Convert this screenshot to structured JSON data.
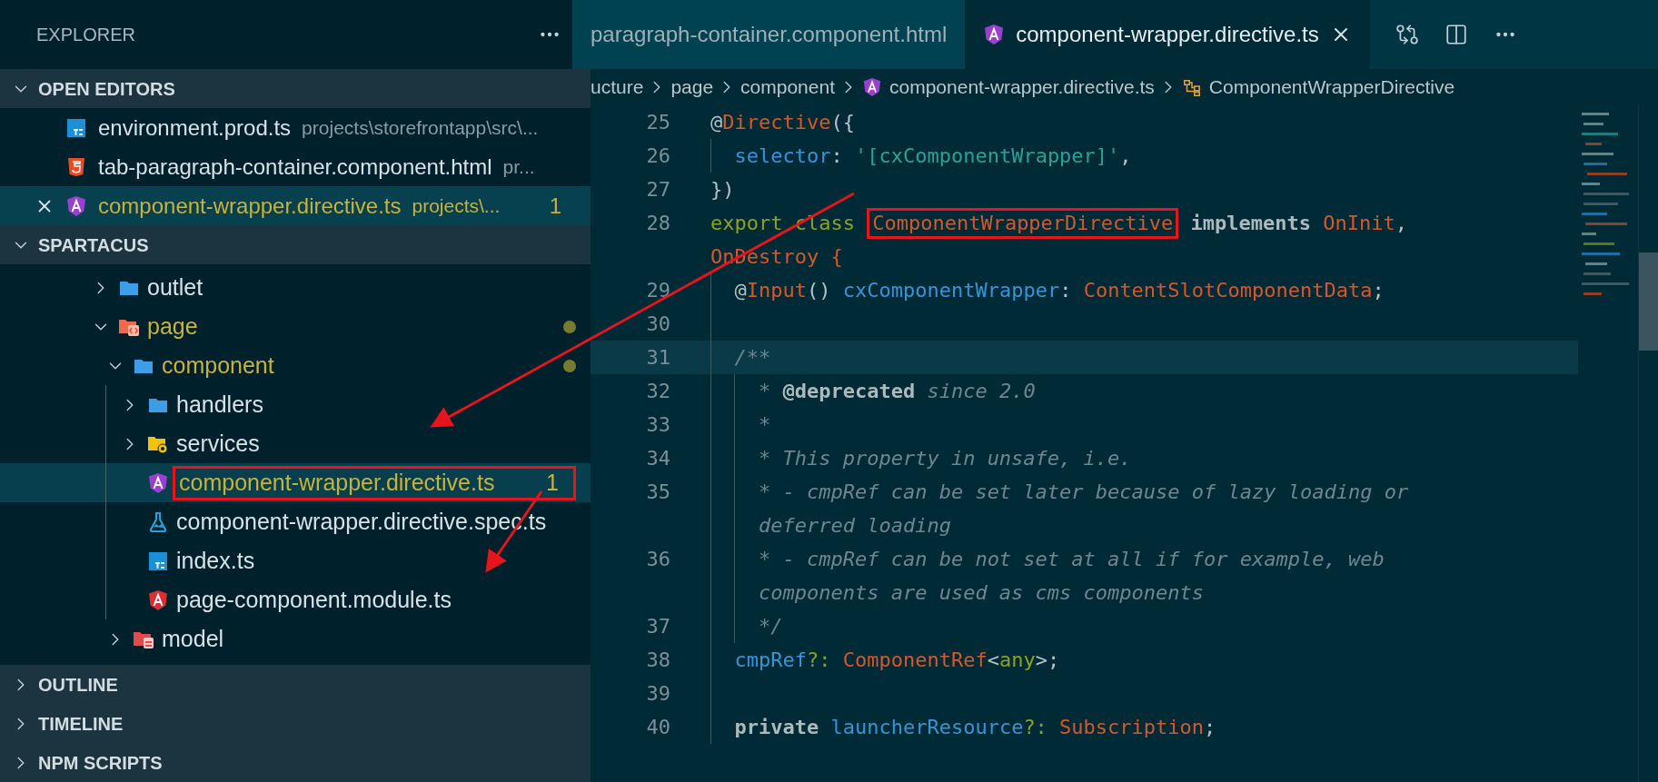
{
  "explorer": {
    "title": "EXPLORER"
  },
  "open_editors": {
    "title": "OPEN EDITORS",
    "expanded": true,
    "items": [
      {
        "name": "environment.prod.ts",
        "path": "projects\\storefrontapp\\src\\...",
        "kind": "ts",
        "selected": false,
        "modified": false
      },
      {
        "name": "tab-paragraph-container.component.html",
        "path": "pr...",
        "kind": "html",
        "selected": false,
        "modified": false
      },
      {
        "name": "component-wrapper.directive.ts",
        "path": "projects\\...",
        "kind": "directive",
        "selected": true,
        "modified": true,
        "badge": "1"
      }
    ]
  },
  "project": {
    "title": "SPARTACUS",
    "expanded": true,
    "tree": [
      {
        "name": "outlet",
        "kind": "folder",
        "expanded": false,
        "modified": false,
        "selected": false
      },
      {
        "name": "page",
        "kind": "folder-page",
        "expanded": true,
        "modified": true,
        "dot": true,
        "selected": false,
        "children": [
          {
            "name": "component",
            "kind": "folder",
            "expanded": true,
            "modified": true,
            "dot": true,
            "selected": false,
            "children": [
              {
                "name": "handlers",
                "kind": "folder",
                "expanded": false,
                "modified": false,
                "selected": false
              },
              {
                "name": "services",
                "kind": "folder-services",
                "expanded": false,
                "modified": false,
                "selected": false
              },
              {
                "name": "component-wrapper.directive.ts",
                "kind": "directive",
                "modified": true,
                "badge": "1",
                "selected": true,
                "highlighted": true
              },
              {
                "name": "component-wrapper.directive.spec.ts",
                "kind": "spec",
                "modified": false,
                "selected": false
              },
              {
                "name": "index.ts",
                "kind": "ts",
                "modified": false,
                "selected": false
              },
              {
                "name": "page-component.module.ts",
                "kind": "module",
                "modified": false,
                "selected": false
              }
            ]
          },
          {
            "name": "model",
            "kind": "folder-model",
            "expanded": false,
            "modified": false,
            "selected": false
          }
        ]
      }
    ]
  },
  "panels": [
    {
      "title": "OUTLINE",
      "expanded": false
    },
    {
      "title": "TIMELINE",
      "expanded": false
    },
    {
      "title": "NPM SCRIPTS",
      "expanded": false
    }
  ],
  "tabs": [
    {
      "label": "paragraph-container.component.html",
      "selected": false
    },
    {
      "label": "component-wrapper.directive.ts",
      "kind": "directive",
      "selected": true
    }
  ],
  "breadcrumbs": [
    {
      "label": "ucture"
    },
    {
      "label": "page"
    },
    {
      "label": "component"
    },
    {
      "label": "component-wrapper.directive.ts",
      "kind": "directive"
    },
    {
      "label": "ComponentWrapperDirective",
      "kind": "class"
    }
  ],
  "code": {
    "lines": [
      {
        "number": "25",
        "current": false,
        "rows": [
          {
            "tokens": [
              {
                "t": "@",
                "kind": "punct"
              },
              {
                "t": "Directive",
                "kind": "type"
              },
              {
                "t": "({",
                "kind": "punct"
              }
            ]
          }
        ]
      },
      {
        "number": "26",
        "current": false,
        "rows": [
          {
            "tokens": [
              {
                "kind": "indent"
              },
              {
                "t": "selector",
                "kind": "prop"
              },
              {
                "t": ": ",
                "kind": "punct"
              },
              {
                "t": "'[cxComponentWrapper]'",
                "kind": "string"
              },
              {
                "t": ",",
                "kind": "punct"
              }
            ]
          }
        ]
      },
      {
        "number": "27",
        "current": false,
        "rows": [
          {
            "tokens": [
              {
                "t": "})",
                "kind": "punct"
              }
            ]
          }
        ]
      },
      {
        "number": "28",
        "current": false,
        "rows": [
          {
            "tokens": [
              {
                "t": "export class ",
                "kind": "keyword"
              },
              {
                "t": "ComponentWrapperDirective",
                "kind": "type",
                "highlighted": true
              },
              {
                "t": " implements ",
                "kind": "bold"
              },
              {
                "t": "OnInit",
                "kind": "type"
              },
              {
                "t": ",",
                "kind": "punct"
              }
            ]
          },
          {
            "tokens": [
              {
                "t": "OnDestroy {",
                "kind": "type"
              }
            ]
          }
        ]
      },
      {
        "number": "29",
        "current": false,
        "rows": [
          {
            "tokens": [
              {
                "kind": "indent"
              },
              {
                "t": "@",
                "kind": "punct"
              },
              {
                "t": "Input",
                "kind": "type"
              },
              {
                "t": "() ",
                "kind": "punct"
              },
              {
                "t": "cxComponentWrapper",
                "kind": "prop"
              },
              {
                "t": ": ",
                "kind": "punct"
              },
              {
                "t": "ContentSlotComponentData",
                "kind": "type"
              },
              {
                "t": ";",
                "kind": "punct"
              }
            ]
          }
        ]
      },
      {
        "number": "30",
        "current": false,
        "rows": [
          {
            "tokens": [
              {
                "kind": "indent"
              }
            ]
          }
        ]
      },
      {
        "number": "31",
        "current": true,
        "rows": [
          {
            "tokens": [
              {
                "kind": "indent"
              },
              {
                "t": "/**",
                "kind": "comment"
              }
            ]
          }
        ]
      },
      {
        "number": "32",
        "current": false,
        "rows": [
          {
            "tokens": [
              {
                "kind": "indent"
              },
              {
                "kind": "indent"
              },
              {
                "t": "* ",
                "kind": "comment"
              },
              {
                "t": "@deprecated",
                "kind": "doctag"
              },
              {
                "t": " since 2.0",
                "kind": "comment"
              }
            ]
          }
        ]
      },
      {
        "number": "33",
        "current": false,
        "rows": [
          {
            "tokens": [
              {
                "kind": "indent"
              },
              {
                "kind": "indent"
              },
              {
                "t": "*",
                "kind": "comment"
              }
            ]
          }
        ]
      },
      {
        "number": "34",
        "current": false,
        "rows": [
          {
            "tokens": [
              {
                "kind": "indent"
              },
              {
                "kind": "indent"
              },
              {
                "t": "* This property in unsafe, i.e.",
                "kind": "comment"
              }
            ]
          }
        ]
      },
      {
        "number": "35",
        "current": false,
        "rows": [
          {
            "tokens": [
              {
                "kind": "indent"
              },
              {
                "kind": "indent"
              },
              {
                "t": "* - cmpRef can be set later because of lazy loading or",
                "kind": "comment"
              }
            ]
          },
          {
            "tokens": [
              {
                "kind": "indent"
              },
              {
                "kind": "indent"
              },
              {
                "t": "deferred loading",
                "kind": "comment"
              }
            ]
          }
        ]
      },
      {
        "number": "36",
        "current": false,
        "rows": [
          {
            "tokens": [
              {
                "kind": "indent"
              },
              {
                "kind": "indent"
              },
              {
                "t": "* - cmpRef can be not set at all if for example, web",
                "kind": "comment"
              }
            ]
          },
          {
            "tokens": [
              {
                "kind": "indent"
              },
              {
                "kind": "indent"
              },
              {
                "t": "components are used as cms components",
                "kind": "comment"
              }
            ]
          }
        ]
      },
      {
        "number": "37",
        "current": false,
        "rows": [
          {
            "tokens": [
              {
                "kind": "indent"
              },
              {
                "kind": "indent"
              },
              {
                "t": "*/",
                "kind": "comment"
              }
            ]
          }
        ]
      },
      {
        "number": "38",
        "current": false,
        "rows": [
          {
            "tokens": [
              {
                "kind": "indent"
              },
              {
                "t": "cmpRef",
                "kind": "prop"
              },
              {
                "t": "?:",
                "kind": "keyword"
              },
              {
                "t": " ComponentRef",
                "kind": "type"
              },
              {
                "t": "<",
                "kind": "punct"
              },
              {
                "t": "any",
                "kind": "keyword"
              },
              {
                "t": ">;",
                "kind": "punct"
              }
            ]
          }
        ]
      },
      {
        "number": "39",
        "current": false,
        "rows": [
          {
            "tokens": [
              {
                "kind": "indent"
              }
            ]
          }
        ]
      },
      {
        "number": "40",
        "current": false,
        "rows": [
          {
            "tokens": [
              {
                "kind": "indent"
              },
              {
                "t": "private ",
                "kind": "bold"
              },
              {
                "t": "launcherResource",
                "kind": "prop"
              },
              {
                "t": "?:",
                "kind": "keyword"
              },
              {
                "t": " Subscription",
                "kind": "type"
              },
              {
                "t": ";",
                "kind": "punct"
              }
            ]
          }
        ]
      }
    ]
  }
}
